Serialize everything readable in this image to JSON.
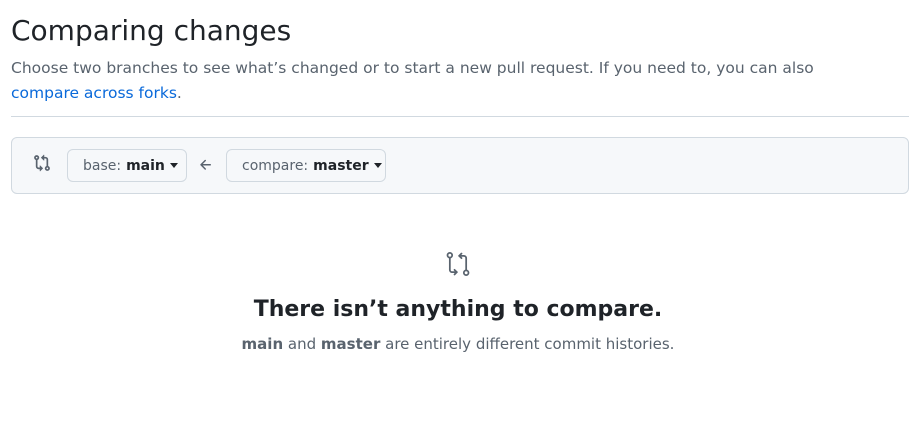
{
  "header": {
    "title": "Comparing changes",
    "description": "Choose two branches to see what’s changed or to start a new pull request. If you need to, you can also",
    "forks_link": "compare across forks",
    "forks_link_suffix": "."
  },
  "range": {
    "icon": "git-compare-icon",
    "base_prefix": "base:",
    "base_branch": "main",
    "arrow_icon": "arrow-left-icon",
    "compare_prefix": "compare:",
    "compare_branch": "master"
  },
  "blankslate": {
    "icon": "git-compare-icon",
    "title": "There isn’t anything to compare.",
    "branch_a": "main",
    "connector": "and",
    "branch_b": "master",
    "message": "are entirely different commit histories."
  },
  "colors": {
    "link": "#0969da",
    "text": "#1f2328",
    "muted": "#59636e",
    "border": "#d1d9e0",
    "box_bg": "#f6f8fa"
  }
}
